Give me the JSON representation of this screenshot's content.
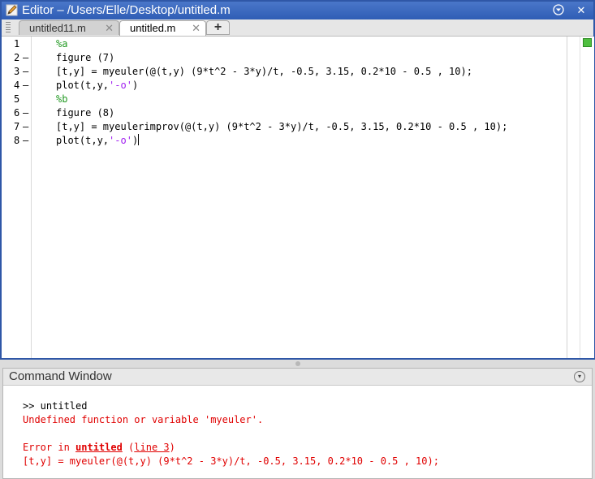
{
  "editor": {
    "title": "Editor – /Users/Elle/Desktop/untitled.m",
    "menu_glyph": "▾",
    "close_glyph": "✕",
    "tabs": [
      {
        "label": "untitled11.m",
        "close": "✕"
      },
      {
        "label": "untitled.m",
        "close": "✕"
      }
    ],
    "add_tab": "+",
    "lines": [
      {
        "num": "1",
        "dash": ""
      },
      {
        "num": "2",
        "dash": "–"
      },
      {
        "num": "3",
        "dash": "–"
      },
      {
        "num": "4",
        "dash": "–"
      },
      {
        "num": "5",
        "dash": ""
      },
      {
        "num": "6",
        "dash": "–"
      },
      {
        "num": "7",
        "dash": "–"
      },
      {
        "num": "8",
        "dash": "–"
      }
    ],
    "code": {
      "l1": "%a",
      "l2": "figure (7)",
      "l3": "[t,y] = myeuler(@(t,y) (9*t^2 - 3*y)/t, -0.5, 3.15, 0.2*10 - 0.5 , 10);",
      "l4_pre": "plot(t,y,",
      "l4_str": "'-o'",
      "l4_post": ")",
      "l5": "%b",
      "l6": "figure (8)",
      "l7": "[t,y] = myeulerimprov(@(t,y) (9*t^2 - 3*y)/t, -0.5, 3.15, 0.2*10 - 0.5 , 10);",
      "l8_pre": "plot(t,y,",
      "l8_str": "'-o'",
      "l8_post": ")"
    }
  },
  "command_window": {
    "title": "Command Window",
    "menu_glyph": "▾",
    "prompt_line": ">> untitled",
    "error_line": "Undefined function or variable 'myeuler'.",
    "error_in_prefix": "Error in ",
    "error_in_file": "untitled",
    "error_in_open": " (",
    "error_in_line": "line 3",
    "error_in_close": ")",
    "error_code": "[t,y] = myeuler(@(t,y) (9*t^2 - 3*y)/t, -0.5, 3.15, 0.2*10 - 0.5 , 10);"
  }
}
